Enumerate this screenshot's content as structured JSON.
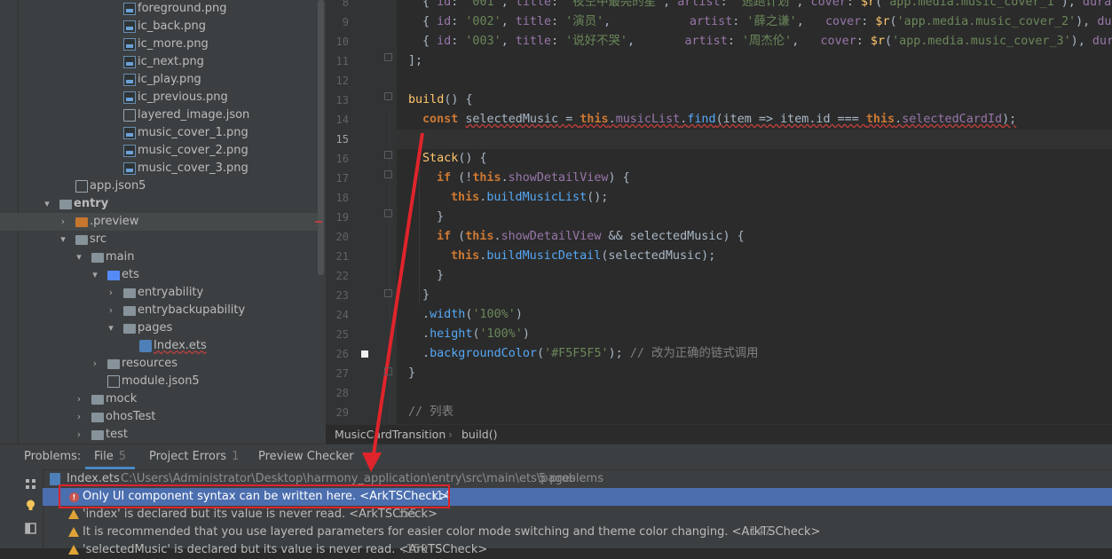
{
  "project_tree": [
    {
      "label": "foreground.png",
      "icon": "image-file-icon",
      "indent": 139,
      "arrow": ""
    },
    {
      "label": "ic_back.png",
      "icon": "image-file-icon",
      "indent": 139,
      "arrow": ""
    },
    {
      "label": "ic_more.png",
      "icon": "image-file-icon",
      "indent": 139,
      "arrow": ""
    },
    {
      "label": "ic_next.png",
      "icon": "image-file-icon",
      "indent": 139,
      "arrow": ""
    },
    {
      "label": "ic_play.png",
      "icon": "image-file-icon",
      "indent": 139,
      "arrow": ""
    },
    {
      "label": "ic_previous.png",
      "icon": "image-file-icon",
      "indent": 139,
      "arrow": ""
    },
    {
      "label": "layered_image.json",
      "icon": "json-file-icon",
      "indent": 139,
      "arrow": ""
    },
    {
      "label": "music_cover_1.png",
      "icon": "image-file-icon",
      "indent": 139,
      "arrow": ""
    },
    {
      "label": "music_cover_2.png",
      "icon": "image-file-icon",
      "indent": 139,
      "arrow": ""
    },
    {
      "label": "music_cover_3.png",
      "icon": "image-file-icon",
      "indent": 139,
      "arrow": ""
    },
    {
      "label": "app.json5",
      "icon": "json-file-icon",
      "indent": 85,
      "arrow": ""
    },
    {
      "label": "entry",
      "icon": "module-folder-icon",
      "indent": 67,
      "arrow": "▾",
      "bold": true
    },
    {
      "label": ".preview",
      "icon": "orange-folder-icon",
      "indent": 85,
      "arrow": "›",
      "selected": true
    },
    {
      "label": "src",
      "icon": "folder-icon",
      "indent": 85,
      "arrow": "▾"
    },
    {
      "label": "main",
      "icon": "folder-icon",
      "indent": 103,
      "arrow": "▾"
    },
    {
      "label": "ets",
      "icon": "blue-folder-icon",
      "indent": 121,
      "arrow": "▾"
    },
    {
      "label": "entryability",
      "icon": "folder-icon",
      "indent": 139,
      "arrow": "›"
    },
    {
      "label": "entrybackupability",
      "icon": "folder-icon",
      "indent": 139,
      "arrow": "›"
    },
    {
      "label": "pages",
      "icon": "folder-icon",
      "indent": 139,
      "arrow": "▾"
    },
    {
      "label": "Index.ets",
      "icon": "ets-file-icon",
      "indent": 157,
      "arrow": "",
      "error": true
    },
    {
      "label": "resources",
      "icon": "folder-icon",
      "indent": 121,
      "arrow": "›"
    },
    {
      "label": "module.json5",
      "icon": "json-file-icon",
      "indent": 121,
      "arrow": ""
    },
    {
      "label": "mock",
      "icon": "folder-icon",
      "indent": 103,
      "arrow": "›"
    },
    {
      "label": "ohosTest",
      "icon": "folder-icon",
      "indent": 103,
      "arrow": "›"
    },
    {
      "label": "test",
      "icon": "folder-icon",
      "indent": 103,
      "arrow": "›"
    }
  ],
  "line_numbers": [
    "8",
    "9",
    "10",
    "11",
    "12",
    "13",
    "14",
    "15",
    "16",
    "17",
    "18",
    "19",
    "20",
    "21",
    "22",
    "23",
    "24",
    "25",
    "26",
    "27",
    "28",
    "29"
  ],
  "current_line": "15",
  "code": {
    "l8": {
      "open": "{ ",
      "id_k": "id",
      "c1": ": ",
      "id_v": "'001'",
      "c2": ", ",
      "title_k": "title",
      "c3": ": ",
      "title_v": "'夜空中最亮的星'",
      "c4": ", ",
      "artist_k": "artist",
      "c5": ": ",
      "artist_v": "'逃跑计划'",
      "c6": ", ",
      "cover_k": "cover",
      "c7": ": ",
      "r": "$r",
      "p1": "(",
      "cover_v": "'app.media.music_cover_1'",
      "p2": "), ",
      "dur": "durat"
    },
    "l9": {
      "open": "{ ",
      "id_k": "id",
      "c1": ": ",
      "id_v": "'002'",
      "c2": ", ",
      "title_k": "title",
      "c3": ": ",
      "title_v": "'演员'",
      "c4": ",           ",
      "artist_k": "artist",
      "c5": ": ",
      "artist_v": "'薛之谦'",
      "c6": ",   ",
      "cover_k": "cover",
      "c7": ": ",
      "r": "$r",
      "p1": "(",
      "cover_v": "'app.media.music_cover_2'",
      "p2": "), ",
      "dur": "dur"
    },
    "l10": {
      "open": "{ ",
      "id_k": "id",
      "c1": ": ",
      "id_v": "'003'",
      "c2": ", ",
      "title_k": "title",
      "c3": ": ",
      "title_v": "'说好不哭'",
      "c4": ",       ",
      "artist_k": "artist",
      "c5": ": ",
      "artist_v": "'周杰伦'",
      "c6": ",   ",
      "cover_k": "cover",
      "c7": ": ",
      "r": "$r",
      "p1": "(",
      "cover_v": "'app.media.music_cover_3'",
      "p2": "), ",
      "dur": "dura"
    },
    "l11": "];",
    "l13": {
      "fn": "build",
      "rest": "() {"
    },
    "l14": {
      "kw": "const",
      "sp": " ",
      "name": "selectedMusic",
      "eq": " = ",
      "this": "this",
      "dot": ".",
      "prop": "musicList",
      "dot2": ".",
      "m": "find",
      "p": "(item => item.id === ",
      "this2": "this",
      "dot3": ".",
      "prop2": "selectedCardId",
      "end": ");"
    },
    "l16": {
      "fn": "Stack",
      "rest": "() {"
    },
    "l17": {
      "kw": "if",
      "a": " (!",
      "this": "this",
      "dot": ".",
      "prop": "showDetailView",
      "b": ") {"
    },
    "l18": {
      "this": "this",
      "dot": ".",
      "m": "buildMusicList",
      "b": "();"
    },
    "l19": "}",
    "l20": {
      "kw": "if",
      "a": " (",
      "this": "this",
      "dot": ".",
      "prop": "showDetailView",
      "b": " && selectedMusic) {"
    },
    "l21": {
      "this": "this",
      "dot": ".",
      "m": "buildMusicDetail",
      "b": "(selectedMusic);"
    },
    "l22": "}",
    "l23": "}",
    "l24": {
      "dot": ".",
      "m": "width",
      "a": "(",
      "v": "'100%'",
      "b": ")"
    },
    "l25": {
      "dot": ".",
      "m": "height",
      "a": "(",
      "v": "'100%'",
      "b": ")"
    },
    "l26": {
      "dot": ".",
      "m": "backgroundColor",
      "a": "(",
      "v": "'#F5F5F5'",
      "b": "); ",
      "cmt": "// 改为正确的链式调用"
    },
    "l27": "}",
    "l29": "// 列表"
  },
  "breadcrumb": {
    "item1": "MusicCardTransition",
    "sep": "›",
    "item2": "build()"
  },
  "problems": {
    "label": "Problems:",
    "tabs": [
      {
        "label": "File",
        "count": "5"
      },
      {
        "label": "Project Errors",
        "count": "1"
      },
      {
        "label": "Preview Checker",
        "count": ""
      }
    ],
    "file": {
      "name": "Index.ets",
      "path": "C:\\Users\\Administrator\\Desktop\\harmony_application\\entry\\src\\main\\ets\\pages",
      "count": "5 problems"
    },
    "rows": [
      {
        "type": "error",
        "text": "Only UI component syntax can be written here. <ArkTSCheck>",
        "loc": ":14"
      },
      {
        "type": "warning",
        "text": "'index' is declared but its value is never read. <ArkTSCheck>",
        "loc": ":55"
      },
      {
        "type": "warning",
        "text": "It is recommended that you use layered parameters for easier color mode switching and theme color changing. <ArkTSCheck>",
        "loc": ":147"
      },
      {
        "type": "warning",
        "text": "'selectedMusic' is declared but its value is never read. <ArkTSCheck>",
        "loc": ":150"
      }
    ]
  },
  "colors": {
    "highlight": "#e0242b",
    "selection": "#4b6eaf",
    "accent": "#4a88c7"
  }
}
